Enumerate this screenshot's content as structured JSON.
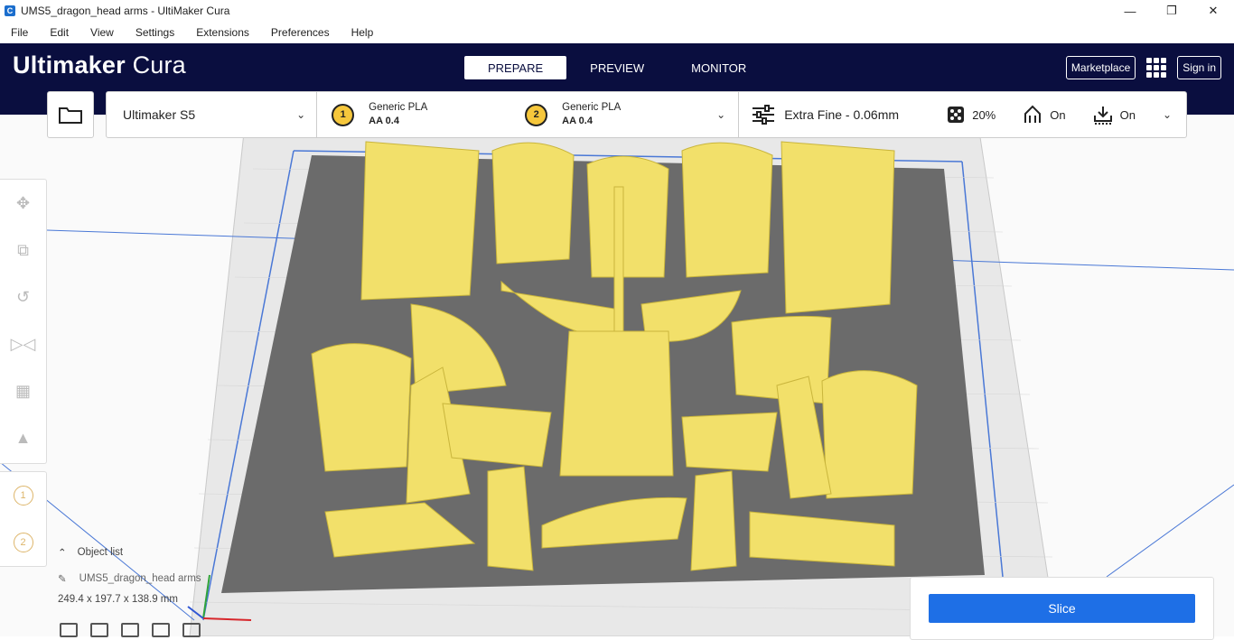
{
  "window": {
    "title": "UMS5_dragon_head arms - UltiMaker Cura",
    "minimize": "—",
    "maximize": "❐",
    "close": "✕"
  },
  "menu": [
    "File",
    "Edit",
    "View",
    "Settings",
    "Extensions",
    "Preferences",
    "Help"
  ],
  "header": {
    "logo_bold": "Ultimaker",
    "logo_light": "Cura",
    "tabs": [
      {
        "label": "PREPARE",
        "active": true
      },
      {
        "label": "PREVIEW",
        "active": false
      },
      {
        "label": "MONITOR",
        "active": false
      }
    ],
    "marketplace": "Marketplace",
    "sign_in": "Sign in"
  },
  "printer": {
    "name": "Ultimaker S5"
  },
  "extruders": [
    {
      "number": "1",
      "material": "Generic PLA",
      "core": "AA 0.4"
    },
    {
      "number": "2",
      "material": "Generic PLA",
      "core": "AA 0.4"
    }
  ],
  "print_settings": {
    "profile": "Extra Fine - 0.06mm",
    "infill": "20%",
    "support": "On",
    "adhesion": "On"
  },
  "left_tools": [
    "move-icon",
    "scale-icon",
    "rotate-icon",
    "mirror-icon",
    "per-model-settings-icon",
    "support-blocker-icon"
  ],
  "object_list": {
    "label": "Object list",
    "object_name": "UMS5_dragon_head arms",
    "dimensions": "249.4 x 197.7 x 138.9 mm"
  },
  "slice_button": "Slice",
  "colors": {
    "header": "#0a0e3f",
    "accent": "#1e6fe6",
    "model": "#f4e26b",
    "plate": "#6e6e6e"
  }
}
